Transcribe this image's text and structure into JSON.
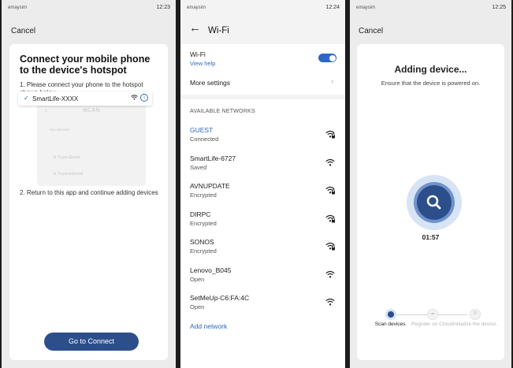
{
  "panel1": {
    "status": {
      "carrier": "emaysim",
      "time": "12:23"
    },
    "cancel": "Cancel",
    "title": "Connect your mobile phone to the device's hotspot",
    "step1": "1. Please connect your phone to the hotspot shown below",
    "wlan": {
      "header": "WLAN",
      "my_networks": "My networks",
      "selected_ssid": "SmartLife-XXXX",
      "others": [
        "Tuya-Guest",
        "Tuya-Internet"
      ]
    },
    "step2": "2. Return to this app and continue adding devices",
    "button": "Go to Connect"
  },
  "panel2": {
    "status": {
      "carrier": "emaysim",
      "time": "12:24"
    },
    "title": "Wi-Fi",
    "wifi_label": "Wi-Fi",
    "view_help": "View help",
    "wifi_enabled": true,
    "more_settings": "More settings",
    "available_header": "AVAILABLE NETWORKS",
    "networks": [
      {
        "name": "GUEST",
        "status": "Connected",
        "locked": true,
        "highlight": true
      },
      {
        "name": "SmartLife-6727",
        "status": "Saved",
        "locked": false,
        "highlight": false
      },
      {
        "name": "AVNUPDATE",
        "status": "Encrypted",
        "locked": true,
        "highlight": false
      },
      {
        "name": "DIRPC",
        "status": "Encrypted",
        "locked": true,
        "highlight": false
      },
      {
        "name": "SONOS",
        "status": "Encrypted",
        "locked": true,
        "highlight": false
      },
      {
        "name": "Lenovo_B045",
        "status": "Open",
        "locked": false,
        "highlight": false
      },
      {
        "name": "SetMeUp-C6:FA:4C",
        "status": "Open",
        "locked": false,
        "highlight": false
      }
    ],
    "add_network": "Add network"
  },
  "panel3": {
    "status": {
      "carrier": "emaysim",
      "time": "12:25"
    },
    "cancel": "Cancel",
    "title": "Adding device...",
    "subtitle": "Ensure that the device is powered on.",
    "timer": "01:57",
    "steps": [
      {
        "label": "Scan devices.",
        "active": true
      },
      {
        "label": "Register on Cloud.",
        "active": false
      },
      {
        "label": "Initialize the device.",
        "active": false
      }
    ]
  },
  "colors": {
    "accent": "#2c4f8c",
    "link": "#2d67c4",
    "ring_light": "#d7e4f5"
  },
  "icons": [
    "back-arrow-icon",
    "wifi-icon",
    "wifi-lock-icon",
    "chevron-right-icon",
    "search-icon",
    "check-icon",
    "info-icon"
  ]
}
